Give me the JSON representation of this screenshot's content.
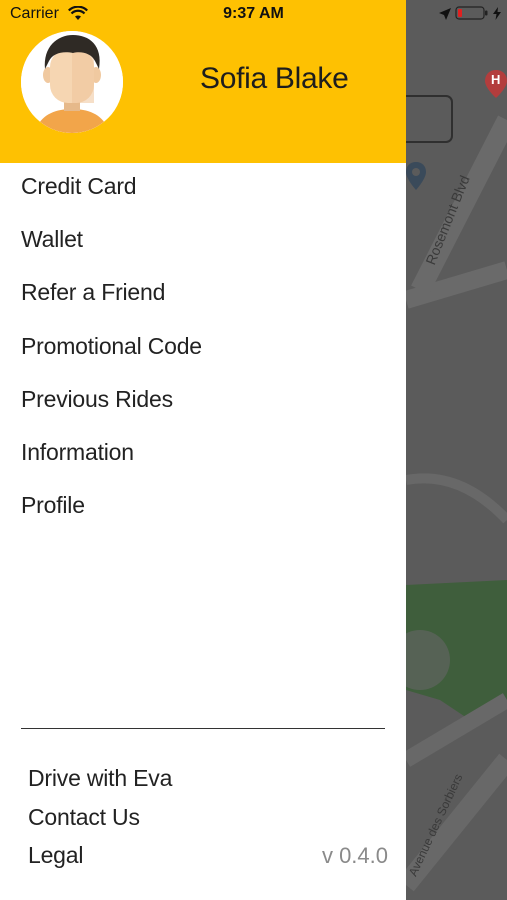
{
  "status_bar": {
    "carrier": "Carrier",
    "time": "9:37 AM"
  },
  "drawer": {
    "user_name": "Sofia Blake",
    "menu_items": [
      {
        "label": "Credit Card"
      },
      {
        "label": "Wallet"
      },
      {
        "label": "Refer a Friend"
      },
      {
        "label": "Promotional Code"
      },
      {
        "label": "Previous Rides"
      },
      {
        "label": "Information"
      },
      {
        "label": "Profile"
      }
    ],
    "footer_items": [
      {
        "label": "Drive with Eva"
      },
      {
        "label": "Contact Us"
      },
      {
        "label": "Legal"
      }
    ],
    "version": "v 0.4.0"
  },
  "map": {
    "street_labels": [
      "Rosemont Blvd",
      "Avenue des Sorbiers"
    ],
    "poi_badge": "H"
  },
  "colors": {
    "header_yellow": "#fec102",
    "map_overlay": "#5b5b5b",
    "park_green": "#3f5e3c"
  },
  "icons": [
    "wifi-icon",
    "location-arrow-icon",
    "battery-icon",
    "charging-bolt-icon",
    "avatar-icon",
    "map-pin-icon",
    "hospital-pin-icon"
  ]
}
